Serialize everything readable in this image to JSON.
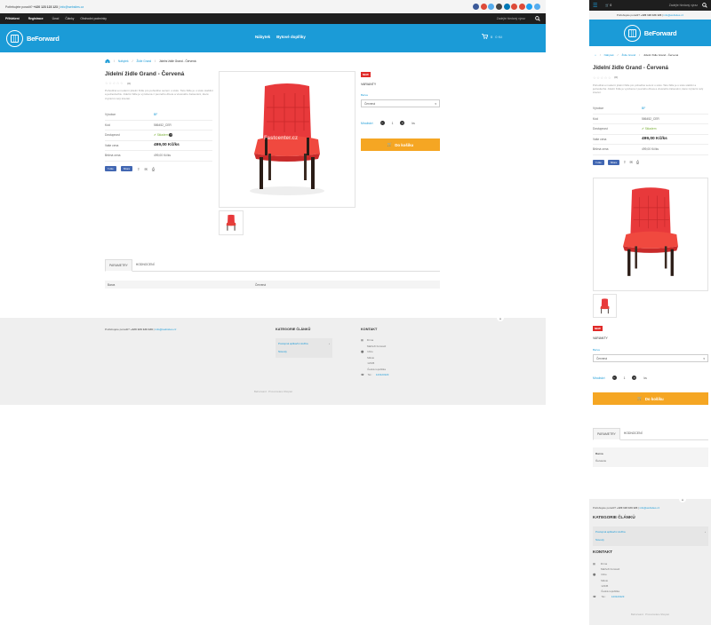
{
  "contact": {
    "prefix": "Potřebujete poradit?",
    "phone": "+420 123 123 123",
    "email": "info@websites.cz",
    "footer_prefix": "Potřebujete poradit?"
  },
  "social_colors": [
    "#3b5998",
    "#dd4b39",
    "#55acee",
    "#444",
    "#0077b5",
    "#dd4b39",
    "#dd4b39",
    "#1da1f2",
    "#55acee"
  ],
  "nav": {
    "login": "Přihlášení",
    "register": "Registrace",
    "links": [
      "Úvod",
      "Články",
      "Obchodní podmínky"
    ],
    "search_placeholder": "Zadejte hledaný výraz"
  },
  "header": {
    "logo_text": "BeForward",
    "menu": [
      "Nábytek",
      "Bytové doplňky"
    ],
    "cart_count": "0",
    "cart_total": "0 Kč"
  },
  "breadcrumb": [
    "Nábytek",
    "Židle Grand",
    "Jídelní židle Grand - Červená"
  ],
  "product": {
    "title": "Jídelní židle Grand - Červená",
    "rating_count": "(0)",
    "description": "Pohodlná a moderní jídelní židle pro pohodlné sezení u stolu. Tato židle je u stolu stabilní a jednoduchá. Jídelní židle je vyrobena z pevného dřeva a vkusného čalounění, které zvýrazní celý interiér.",
    "specs": [
      {
        "label": "Výrobce",
        "value": "BF"
      },
      {
        "label": "Kód",
        "value": "586452_CER"
      },
      {
        "label": "Dostupnost",
        "value": "Skladem"
      },
      {
        "label": "Vaše cena",
        "value": "499,00 Kč/ks"
      },
      {
        "label": "Běžná cena",
        "value": "499,00 Kč/ks"
      }
    ],
    "badge": "NEW",
    "variants_label": "VARIANTY",
    "color_label": "Barva",
    "color_value": "Červená",
    "qty_label": "Množství",
    "qty": "1",
    "unit": "ks",
    "buy_label": "Do košíku",
    "fb_like": "Like",
    "fb_share": "Share"
  },
  "tabs": [
    "PARAMETRY",
    "HODNOCENÍ"
  ],
  "params": [
    {
      "k": "Barva",
      "v": "Červená"
    }
  ],
  "footer": {
    "cat_heading": "KATEGORIE ČLÁNKŮ",
    "cat_items": [
      "Postupná aplikační služba",
      "Návody"
    ],
    "contact_heading": "KONTAKT",
    "address": [
      "Firma",
      "Nábřeží Forward",
      "Ulice",
      "Město",
      "12345",
      "Česká republika"
    ],
    "tel_label": "Tel.:",
    "tel": "123123123",
    "copyright": "BeForward · Provozováno Shoptet"
  },
  "watermark": "Fastcenter.cz",
  "mobile": {
    "cart_count": "0",
    "mobile_tabs": [
      "PARAMETRY",
      "HODNOCENÍ"
    ]
  }
}
